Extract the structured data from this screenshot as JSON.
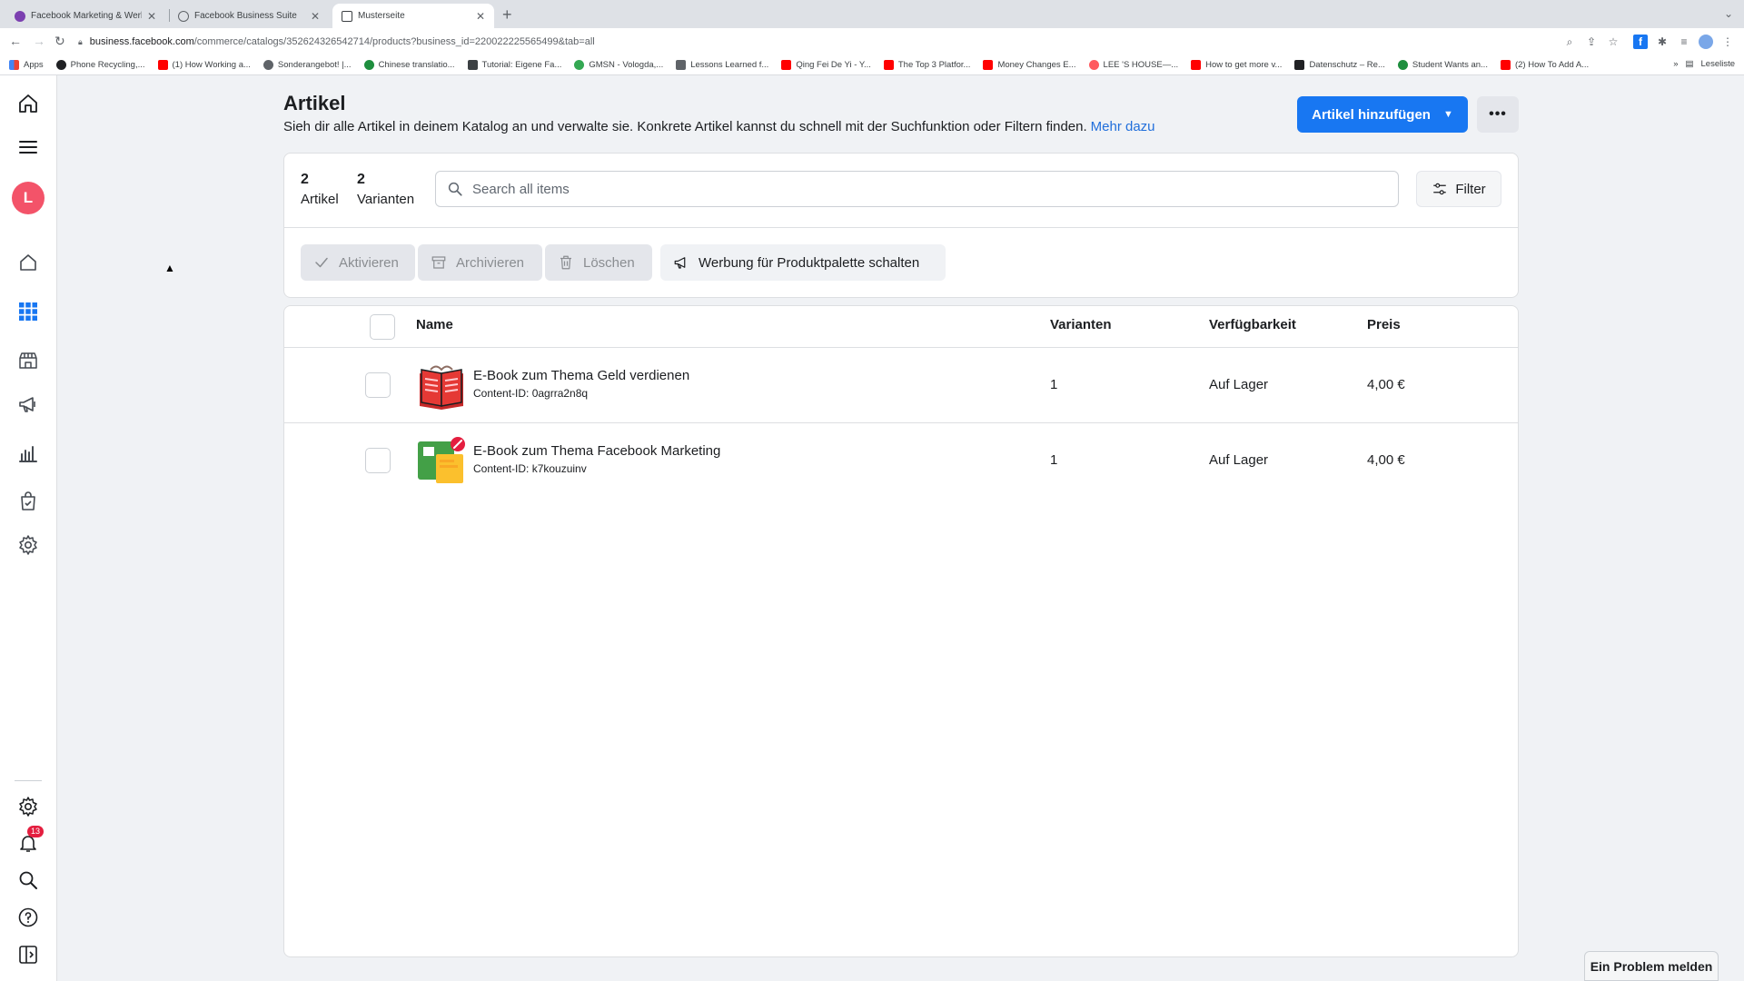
{
  "browser": {
    "tabs": [
      {
        "title": "Facebook Marketing & Werbea",
        "favicon_color": "#7b3fb0",
        "active": false
      },
      {
        "title": "Facebook Business Suite",
        "favicon_color": "#ffffff",
        "active": false
      },
      {
        "title": "Musterseite",
        "favicon_color": "#3c4043",
        "active": true
      }
    ],
    "url_host": "business.facebook.com",
    "url_path": "/commerce/catalogs/352624326542714/products?business_id=220022225565499&tab=all",
    "bookmarks": [
      {
        "label": "Apps",
        "color": "#4285f4"
      },
      {
        "label": "Phone Recycling,...",
        "color": "#202124"
      },
      {
        "label": "(1) How Working a...",
        "color": "#ff0000"
      },
      {
        "label": "Sonderangebot! |...",
        "color": "#5f6368"
      },
      {
        "label": "Chinese translatio...",
        "color": "#1e8e3e"
      },
      {
        "label": "Tutorial: Eigene Fa...",
        "color": "#3c4043"
      },
      {
        "label": "GMSN - Vologda,...",
        "color": "#34a853"
      },
      {
        "label": "Lessons Learned f...",
        "color": "#5f6368"
      },
      {
        "label": "Qing Fei De Yi - Y...",
        "color": "#ff0000"
      },
      {
        "label": "The Top 3 Platfor...",
        "color": "#ff0000"
      },
      {
        "label": "Money Changes E...",
        "color": "#ff0000"
      },
      {
        "label": "LEE 'S HOUSE—...",
        "color": "#ff5a5f"
      },
      {
        "label": "How to get more v...",
        "color": "#ff0000"
      },
      {
        "label": "Datenschutz – Re...",
        "color": "#202124"
      },
      {
        "label": "Student Wants an...",
        "color": "#1e8e3e"
      },
      {
        "label": "(2) How To Add A...",
        "color": "#ff0000"
      }
    ],
    "reading_list": "Leseliste"
  },
  "rail": {
    "avatar_letter": "L",
    "notification_count": "13"
  },
  "page": {
    "title": "Artikel",
    "description": "Sieh dir alle Artikel in deinem Katalog an und verwalte sie. Konkrete Artikel kannst du schnell mit der Suchfunktion oder Filtern finden.",
    "learn_more": "Mehr dazu",
    "add_button": "Artikel hinzufügen"
  },
  "stats": {
    "items_count": "2",
    "items_label": "Artikel",
    "variants_count": "2",
    "variants_label": "Varianten"
  },
  "search": {
    "placeholder": "Search all items"
  },
  "filter_label": "Filter",
  "actions": {
    "activate": "Aktivieren",
    "archive": "Archivieren",
    "delete": "Löschen",
    "promote": "Werbung für Produktpalette schalten"
  },
  "table": {
    "headers": {
      "name": "Name",
      "variants": "Varianten",
      "availability": "Verfügbarkeit",
      "price": "Preis"
    },
    "rows": [
      {
        "name": "E-Book zum Thema Geld verdienen",
        "content_id": "Content-ID: 0agrra2n8q",
        "variants": "1",
        "availability": "Auf Lager",
        "price": "4,00 €",
        "icon": "red-book-icon"
      },
      {
        "name": "E-Book zum Thema Facebook Marketing",
        "content_id": "Content-ID: k7kouzuinv",
        "variants": "1",
        "availability": "Auf Lager",
        "price": "4,00 €",
        "icon": "green-book-icon"
      }
    ]
  },
  "report_problem": "Ein Problem melden",
  "colors": {
    "primary": "#1877f2",
    "link": "#216fdb",
    "danger": "#e41e3f"
  }
}
